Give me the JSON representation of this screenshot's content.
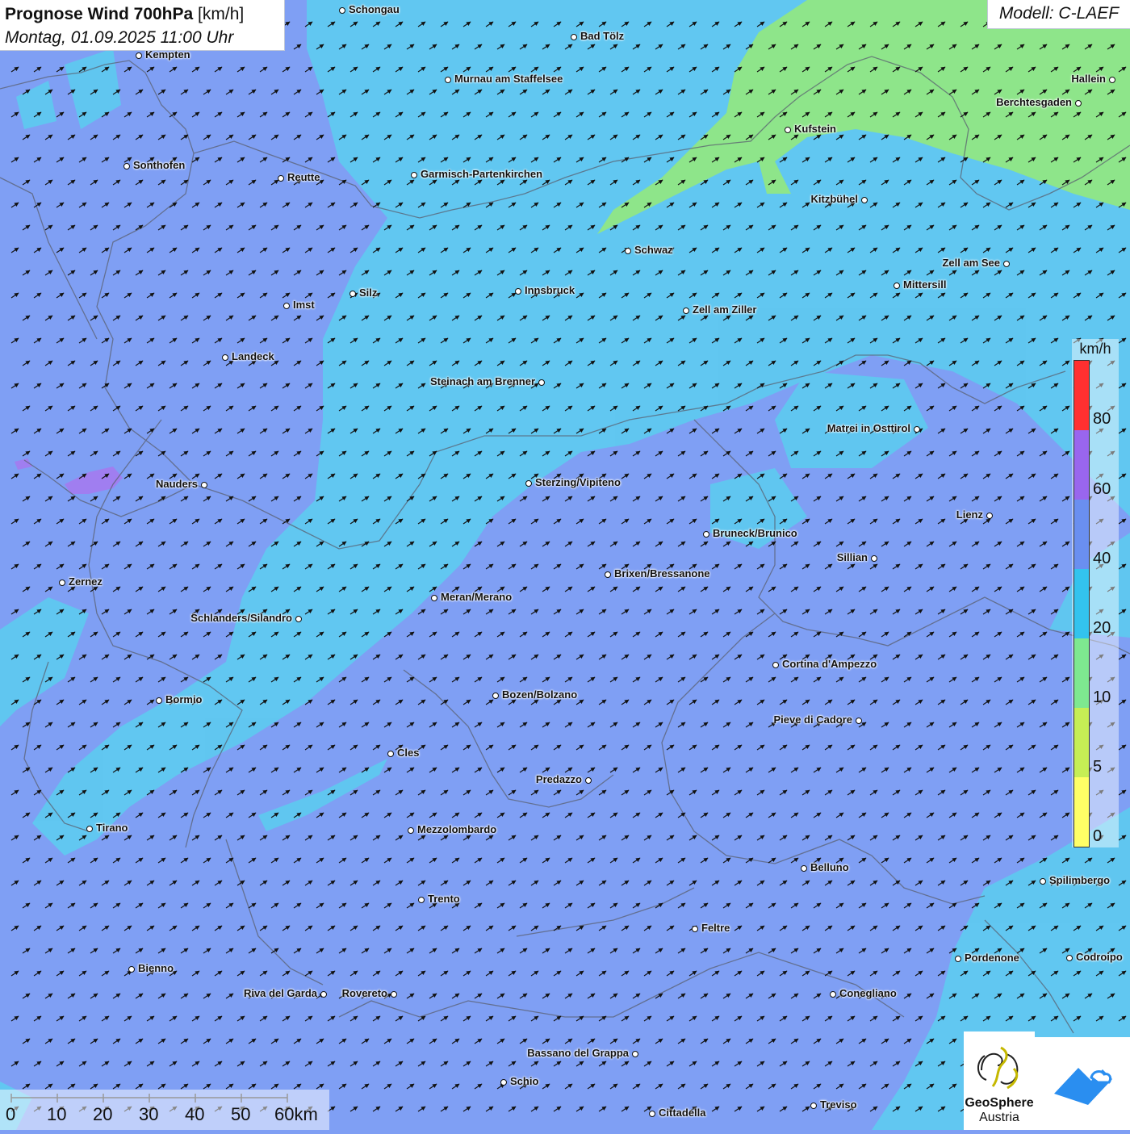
{
  "header": {
    "title_main": "Prognose Wind 700hPa",
    "title_unit": "[km/h]",
    "subtitle": "Montag, 01.09.2025 11:00 Uhr"
  },
  "model_label": "Modell: C-LAEF",
  "legend": {
    "unit": "km/h",
    "ticks": [
      "80",
      "60",
      "40",
      "20",
      "10",
      "5",
      "0"
    ],
    "colors": [
      "#ff3030",
      "#9966ee",
      "#6a8ff0",
      "#33c3ee",
      "#7ee890",
      "#c6ee55",
      "#ffff66"
    ]
  },
  "scale_bar": {
    "labels": [
      "0",
      "10",
      "20",
      "30",
      "40",
      "50",
      "60km"
    ]
  },
  "logos": {
    "geosphere_line1": "GeoSphere",
    "geosphere_line2": "Austria"
  },
  "wind_field": {
    "dominant_direction": "south-west",
    "colors": {
      "background_40_60": "#7f9ff4",
      "band_20_40": "#5ecaf0",
      "band_10_20": "#8ee58a",
      "band_60_80": "#a07ef0"
    }
  },
  "cities": [
    {
      "name": "Schongau"
    },
    {
      "name": "Bad Tölz"
    },
    {
      "name": "Kempten"
    },
    {
      "name": "Murnau am Staffelsee"
    },
    {
      "name": "Hallein"
    },
    {
      "name": "Berchtesgaden"
    },
    {
      "name": "Kufstein"
    },
    {
      "name": "Sonthofen"
    },
    {
      "name": "Reutte"
    },
    {
      "name": "Garmisch-Partenkirchen"
    },
    {
      "name": "Kitzbühel"
    },
    {
      "name": "Schwaz"
    },
    {
      "name": "Zell am See"
    },
    {
      "name": "Mittersill"
    },
    {
      "name": "Innsbruck"
    },
    {
      "name": "Silz"
    },
    {
      "name": "Imst"
    },
    {
      "name": "Zell am Ziller"
    },
    {
      "name": "Landeck"
    },
    {
      "name": "Steinach am Brenner"
    },
    {
      "name": "Matrei in Osttirol"
    },
    {
      "name": "Nauders"
    },
    {
      "name": "Sterzing/Vipiteno"
    },
    {
      "name": "Lienz"
    },
    {
      "name": "Bruneck/Brunico"
    },
    {
      "name": "Sillian"
    },
    {
      "name": "Brixen/Bressanone"
    },
    {
      "name": "Zernez"
    },
    {
      "name": "Meran/Merano"
    },
    {
      "name": "Schlanders/Silandro"
    },
    {
      "name": "Cortina d'Ampezzo"
    },
    {
      "name": "Bozen/Bolzano"
    },
    {
      "name": "Bormio"
    },
    {
      "name": "Pieve di Cadore"
    },
    {
      "name": "Cles"
    },
    {
      "name": "Predazzo"
    },
    {
      "name": "Tirano"
    },
    {
      "name": "Mezzolombardo"
    },
    {
      "name": "Belluno"
    },
    {
      "name": "Spilimbergo"
    },
    {
      "name": "Trento"
    },
    {
      "name": "Feltre"
    },
    {
      "name": "Pordenone"
    },
    {
      "name": "Codroipo"
    },
    {
      "name": "Bienno"
    },
    {
      "name": "Riva del Garda"
    },
    {
      "name": "Rovereto"
    },
    {
      "name": "Conegliano"
    },
    {
      "name": "Bassano del Grappa"
    },
    {
      "name": "Schio"
    },
    {
      "name": "Treviso"
    },
    {
      "name": "Cittadella"
    }
  ]
}
